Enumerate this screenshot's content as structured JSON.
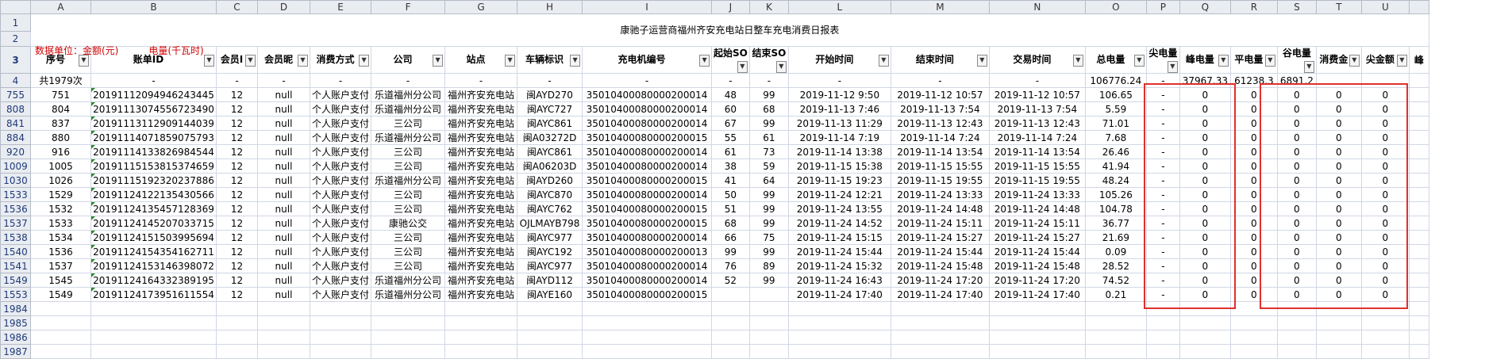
{
  "title": "康驰子运营商福州齐安充电站日整车充电消费日报表",
  "unit_money": "数据单位：金额(元)",
  "unit_power": "电量(千瓦时)",
  "column_letters": [
    "A",
    "B",
    "C",
    "D",
    "E",
    "F",
    "G",
    "H",
    "I",
    "J",
    "K",
    "L",
    "M",
    "N",
    "O",
    "P",
    "Q",
    "R",
    "S",
    "T",
    "U",
    ""
  ],
  "headers": [
    "序号",
    "账单ID",
    "会员I",
    "会员昵",
    "消费方式",
    "公司",
    "站点",
    "车辆标识",
    "充电机编号",
    "起始SO",
    "结束SO",
    "开始时间",
    "结束时间",
    "交易时间",
    "总电量",
    "尖电量",
    "峰电量",
    "平电量",
    "谷电量",
    "消费金",
    "尖金额",
    "峰"
  ],
  "summary_row": {
    "row_num": "4",
    "count": "共1979次",
    "dash": "-",
    "total": "106776.24",
    "jian": "-",
    "feng": "37967.33",
    "ping": "61238.3",
    "gu": "6891.2"
  },
  "header_row_nums": [
    "1",
    "2",
    "3"
  ],
  "rows": [
    {
      "r": "755",
      "a": "751",
      "b": "20191112094946243445",
      "c": "12",
      "d": "null",
      "e": "个人账户支付",
      "f": "乐道福州分公司",
      "g": "福州齐安充电站",
      "h": "闽AYD270",
      "i": "35010400080000200014",
      "j": "48",
      "k": "99",
      "l": "2019-11-12 9:50",
      "m": "2019-11-12 10:57",
      "n": "2019-11-12 10:57",
      "o": "106.65",
      "p": "-",
      "q": "0",
      "r2": "0",
      "s": "0",
      "t": "0",
      "u": "0"
    },
    {
      "r": "808",
      "a": "804",
      "b": "20191113074556723490",
      "c": "12",
      "d": "null",
      "e": "个人账户支付",
      "f": "乐道福州分公司",
      "g": "福州齐安充电站",
      "h": "闽AYC727",
      "i": "35010400080000200014",
      "j": "60",
      "k": "68",
      "l": "2019-11-13 7:46",
      "m": "2019-11-13 7:54",
      "n": "2019-11-13 7:54",
      "o": "5.59",
      "p": "-",
      "q": "0",
      "r2": "0",
      "s": "0",
      "t": "0",
      "u": "0"
    },
    {
      "r": "841",
      "a": "837",
      "b": "20191113112909144039",
      "c": "12",
      "d": "null",
      "e": "个人账户支付",
      "f": "三公司",
      "g": "福州齐安充电站",
      "h": "闽AYC861",
      "i": "35010400080000200014",
      "j": "67",
      "k": "99",
      "l": "2019-11-13 11:29",
      "m": "2019-11-13 12:43",
      "n": "2019-11-13 12:43",
      "o": "71.01",
      "p": "-",
      "q": "0",
      "r2": "0",
      "s": "0",
      "t": "0",
      "u": "0"
    },
    {
      "r": "884",
      "a": "880",
      "b": "20191114071859075793",
      "c": "12",
      "d": "null",
      "e": "个人账户支付",
      "f": "乐道福州分公司",
      "g": "福州齐安充电站",
      "h": "闽A03272D",
      "i": "35010400080000200015",
      "j": "55",
      "k": "61",
      "l": "2019-11-14 7:19",
      "m": "2019-11-14 7:24",
      "n": "2019-11-14 7:24",
      "o": "7.68",
      "p": "-",
      "q": "0",
      "r2": "0",
      "s": "0",
      "t": "0",
      "u": "0"
    },
    {
      "r": "920",
      "a": "916",
      "b": "20191114133826984544",
      "c": "12",
      "d": "null",
      "e": "个人账户支付",
      "f": "三公司",
      "g": "福州齐安充电站",
      "h": "闽AYC861",
      "i": "35010400080000200014",
      "j": "61",
      "k": "73",
      "l": "2019-11-14 13:38",
      "m": "2019-11-14 13:54",
      "n": "2019-11-14 13:54",
      "o": "26.46",
      "p": "-",
      "q": "0",
      "r2": "0",
      "s": "0",
      "t": "0",
      "u": "0"
    },
    {
      "r": "1009",
      "a": "1005",
      "b": "20191115153815374659",
      "c": "12",
      "d": "null",
      "e": "个人账户支付",
      "f": "三公司",
      "g": "福州齐安充电站",
      "h": "闽A06203D",
      "i": "35010400080000200014",
      "j": "38",
      "k": "59",
      "l": "2019-11-15 15:38",
      "m": "2019-11-15 15:55",
      "n": "2019-11-15 15:55",
      "o": "41.94",
      "p": "-",
      "q": "0",
      "r2": "0",
      "s": "0",
      "t": "0",
      "u": "0"
    },
    {
      "r": "1030",
      "a": "1026",
      "b": "20191115192320237886",
      "c": "12",
      "d": "null",
      "e": "个人账户支付",
      "f": "乐道福州分公司",
      "g": "福州齐安充电站",
      "h": "闽AYD260",
      "i": "35010400080000200015",
      "j": "41",
      "k": "64",
      "l": "2019-11-15 19:23",
      "m": "2019-11-15 19:55",
      "n": "2019-11-15 19:55",
      "o": "48.24",
      "p": "-",
      "q": "0",
      "r2": "0",
      "s": "0",
      "t": "0",
      "u": "0"
    },
    {
      "r": "1533",
      "a": "1529",
      "b": "20191124122135430566",
      "c": "12",
      "d": "null",
      "e": "个人账户支付",
      "f": "三公司",
      "g": "福州齐安充电站",
      "h": "闽AYC870",
      "i": "35010400080000200014",
      "j": "50",
      "k": "99",
      "l": "2019-11-24 12:21",
      "m": "2019-11-24 13:33",
      "n": "2019-11-24 13:33",
      "o": "105.26",
      "p": "-",
      "q": "0",
      "r2": "0",
      "s": "0",
      "t": "0",
      "u": "0"
    },
    {
      "r": "1536",
      "a": "1532",
      "b": "20191124135457128369",
      "c": "12",
      "d": "null",
      "e": "个人账户支付",
      "f": "三公司",
      "g": "福州齐安充电站",
      "h": "闽AYC762",
      "i": "35010400080000200015",
      "j": "51",
      "k": "99",
      "l": "2019-11-24 13:55",
      "m": "2019-11-24 14:48",
      "n": "2019-11-24 14:48",
      "o": "104.78",
      "p": "-",
      "q": "0",
      "r2": "0",
      "s": "0",
      "t": "0",
      "u": "0"
    },
    {
      "r": "1537",
      "a": "1533",
      "b": "20191124145207033715",
      "c": "12",
      "d": "null",
      "e": "个人账户支付",
      "f": "康驰公交",
      "g": "福州齐安充电站",
      "h": "OJLMAYB798",
      "i": "35010400080000200015",
      "j": "68",
      "k": "99",
      "l": "2019-11-24 14:52",
      "m": "2019-11-24 15:11",
      "n": "2019-11-24 15:11",
      "o": "36.77",
      "p": "-",
      "q": "0",
      "r2": "0",
      "s": "0",
      "t": "0",
      "u": "0"
    },
    {
      "r": "1538",
      "a": "1534",
      "b": "20191124151503995694",
      "c": "12",
      "d": "null",
      "e": "个人账户支付",
      "f": "三公司",
      "g": "福州齐安充电站",
      "h": "闽AYC977",
      "i": "35010400080000200014",
      "j": "66",
      "k": "75",
      "l": "2019-11-24 15:15",
      "m": "2019-11-24 15:27",
      "n": "2019-11-24 15:27",
      "o": "21.69",
      "p": "-",
      "q": "0",
      "r2": "0",
      "s": "0",
      "t": "0",
      "u": "0"
    },
    {
      "r": "1540",
      "a": "1536",
      "b": "20191124154354162711",
      "c": "12",
      "d": "null",
      "e": "个人账户支付",
      "f": "三公司",
      "g": "福州齐安充电站",
      "h": "闽AYC192",
      "i": "35010400080000200013",
      "j": "99",
      "k": "99",
      "l": "2019-11-24 15:44",
      "m": "2019-11-24 15:44",
      "n": "2019-11-24 15:44",
      "o": "0.09",
      "p": "-",
      "q": "0",
      "r2": "0",
      "s": "0",
      "t": "0",
      "u": "0"
    },
    {
      "r": "1541",
      "a": "1537",
      "b": "20191124153146398072",
      "c": "12",
      "d": "null",
      "e": "个人账户支付",
      "f": "三公司",
      "g": "福州齐安充电站",
      "h": "闽AYC977",
      "i": "35010400080000200014",
      "j": "76",
      "k": "89",
      "l": "2019-11-24 15:32",
      "m": "2019-11-24 15:48",
      "n": "2019-11-24 15:48",
      "o": "28.52",
      "p": "-",
      "q": "0",
      "r2": "0",
      "s": "0",
      "t": "0",
      "u": "0"
    },
    {
      "r": "1549",
      "a": "1545",
      "b": "20191124164332389195",
      "c": "12",
      "d": "null",
      "e": "个人账户支付",
      "f": "乐道福州分公司",
      "g": "福州齐安充电站",
      "h": "闽AYD112",
      "i": "35010400080000200014",
      "j": "52",
      "k": "99",
      "l": "2019-11-24 16:43",
      "m": "2019-11-24 17:20",
      "n": "2019-11-24 17:20",
      "o": "74.52",
      "p": "-",
      "q": "0",
      "r2": "0",
      "s": "0",
      "t": "0",
      "u": "0"
    },
    {
      "r": "1553",
      "a": "1549",
      "b": "20191124173951611554",
      "c": "12",
      "d": "null",
      "e": "个人账户支付",
      "f": "乐道福州分公司",
      "g": "福州齐安充电站",
      "h": "闽AYE160",
      "i": "35010400080000200015",
      "j": "",
      "k": "",
      "l": "2019-11-24 17:40",
      "m": "2019-11-24 17:40",
      "n": "2019-11-24 17:40",
      "o": "0.21",
      "p": "-",
      "q": "0",
      "r2": "0",
      "s": "0",
      "t": "0",
      "u": "0"
    }
  ],
  "empty_rows": [
    "1984",
    "1985",
    "1986",
    "1987"
  ],
  "colors": {
    "header_bg": "#e9ecf1",
    "unit_red": "#d00000",
    "highlight_box": "#e0302c",
    "row_num_blue": "#1f3a78"
  }
}
